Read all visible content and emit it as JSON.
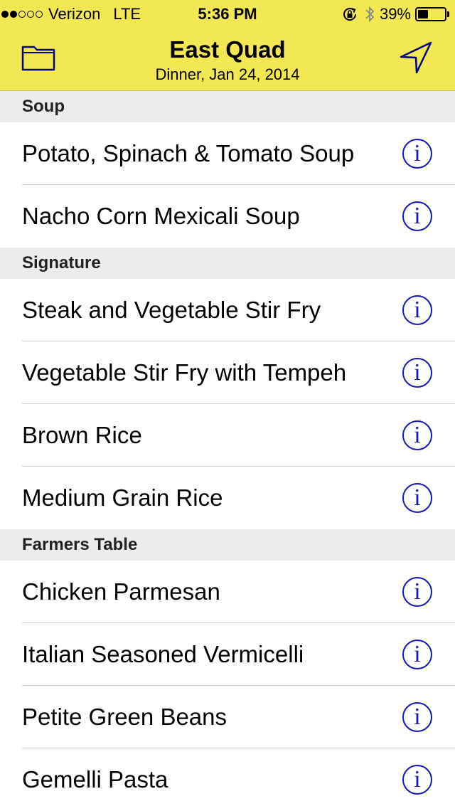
{
  "status_bar": {
    "carrier": "Verizon",
    "network": "LTE",
    "time": "5:36 PM",
    "battery": "39%",
    "battery_level": 0.39,
    "signal_bars": 2
  },
  "nav": {
    "title": "East Quad",
    "subtitle": "Dinner, Jan 24, 2014",
    "left_icon": "folder-icon",
    "right_icon": "location-arrow-icon"
  },
  "colors": {
    "header_bg": "#f1e853",
    "info_accent": "#1616b5",
    "section_bg": "#ececec"
  },
  "info_glyph": "i",
  "sections": [
    {
      "title": "Soup",
      "items": [
        "Potato, Spinach & Tomato Soup",
        "Nacho Corn Mexicali Soup"
      ]
    },
    {
      "title": "Signature",
      "items": [
        "Steak and Vegetable Stir Fry",
        "Vegetable Stir Fry with Tempeh",
        "Brown Rice",
        "Medium Grain Rice"
      ]
    },
    {
      "title": "Farmers Table",
      "items": [
        "Chicken Parmesan",
        "Italian Seasoned Vermicelli",
        "Petite Green Beans",
        "Gemelli Pasta"
      ]
    }
  ]
}
